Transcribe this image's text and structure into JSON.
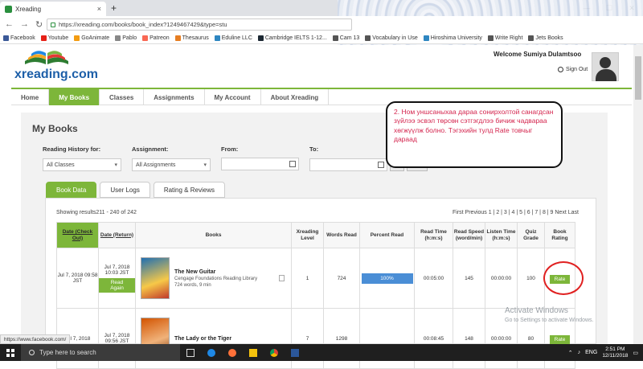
{
  "browser": {
    "tab_title": "Xreading",
    "tab_close": "×",
    "new_tab": "+",
    "back": "←",
    "forward": "→",
    "reload": "↻",
    "url": "https://xreading.com/books/book_index?1249467429&type=stu",
    "bookmarks": [
      {
        "label": "Facebook",
        "color": "#3b5998"
      },
      {
        "label": "Youtube",
        "color": "#e62117"
      },
      {
        "label": "GoAnimate",
        "color": "#f39c12"
      },
      {
        "label": "Pablo",
        "color": "#888888"
      },
      {
        "label": "Patreon",
        "color": "#f96854"
      },
      {
        "label": "Thesaurus",
        "color": "#e67e22"
      },
      {
        "label": "Eduline LLC",
        "color": "#2e86c1"
      },
      {
        "label": "Cambridge IELTS 1-12...",
        "color": "#1c2833"
      },
      {
        "label": "Cam 13",
        "color": "#555555"
      },
      {
        "label": "Vocabulary in Use",
        "color": "#555555"
      },
      {
        "label": "Hiroshima University",
        "color": "#2e86c1"
      },
      {
        "label": "Write Right",
        "color": "#555555"
      },
      {
        "label": "Jets Books",
        "color": "#555555"
      }
    ]
  },
  "header": {
    "logo_text": "xreading.com",
    "welcome": "Welcome Sumiya Dulamtsoo",
    "sign_out": "Sign Out"
  },
  "menu": [
    {
      "label": "Home",
      "active": false
    },
    {
      "label": "My Books",
      "active": true
    },
    {
      "label": "Classes",
      "active": false
    },
    {
      "label": "Assignments",
      "active": false
    },
    {
      "label": "My Account",
      "active": false
    },
    {
      "label": "About Xreading",
      "active": false
    }
  ],
  "page": {
    "title": "My Books",
    "filters": {
      "history_label": "Reading History for:",
      "history_value": "All Classes",
      "assignment_label": "Assignment:",
      "assignment_value": "All Assignments",
      "from_label": "From:",
      "to_label": "To:",
      "go_label": "Go",
      "clear_label": "Clear"
    },
    "tabs": [
      {
        "label": "Book Data",
        "active": true
      },
      {
        "label": "User Logs",
        "active": false
      },
      {
        "label": "Rating & Reviews",
        "active": false
      }
    ],
    "showing": "Showing results211 - 240 of 242",
    "pager": "First Previous 1 | 2 | 3 | 4 | 5 | 6 | 7 | 8 | 9 Next Last"
  },
  "table": {
    "headers": {
      "date_checkout": "Date (Check Out)",
      "date_return": "Date (Return)",
      "books": "Books",
      "level": "Xreading Level",
      "words": "Words Read",
      "percent": "Percent Read",
      "read_time": "Read Time (h:m:s)",
      "read_speed": "Read Speed (word/min)",
      "listen_time": "Listen Time (h:m:s)",
      "quiz": "Quiz Grade",
      "rating": "Book Rating"
    },
    "rows": [
      {
        "checkout": "Jul 7, 2018 09:58 JST",
        "return": "Jul 7, 2018 10:03 JST",
        "read_again": "Read Again",
        "title": "The New Guitar",
        "series": "Cengage Foundations Reading Library",
        "meta": "724 words, 9 min",
        "level": "1",
        "words": "724",
        "percent": "100%",
        "read_time": "00:05:00",
        "speed": "145",
        "listen": "00:00:00",
        "quiz": "100",
        "rate": "Rate"
      },
      {
        "checkout": "Jul 7, 2018",
        "return": "Jul 7, 2018 09:56 JST",
        "read_again": "",
        "title": "The Lady or the Tiger",
        "series": "",
        "meta": "",
        "level": "7",
        "words": "1298",
        "percent": "",
        "read_time": "00:08:45",
        "speed": "148",
        "listen": "00:00:00",
        "quiz": "80",
        "rate": "Rate"
      }
    ]
  },
  "annotation": "2. Ном уншсаныхаа дараа сонирхолтой санагдсан зүйлээ эсвэл төрсөн сэтгэгдлээ бичиж чадвараа хөгжүүлж болно. Тэгэхийн тулд Rate товчыг дараад",
  "watermark": {
    "line1": "Activate Windows",
    "line2": "Go to Settings to activate Windows."
  },
  "status_url": "https://www.facebook.com/",
  "taskbar": {
    "search_placeholder": "Type here to search",
    "time": "2:51 PM",
    "date": "12/11/2018",
    "lang": "ENG"
  }
}
